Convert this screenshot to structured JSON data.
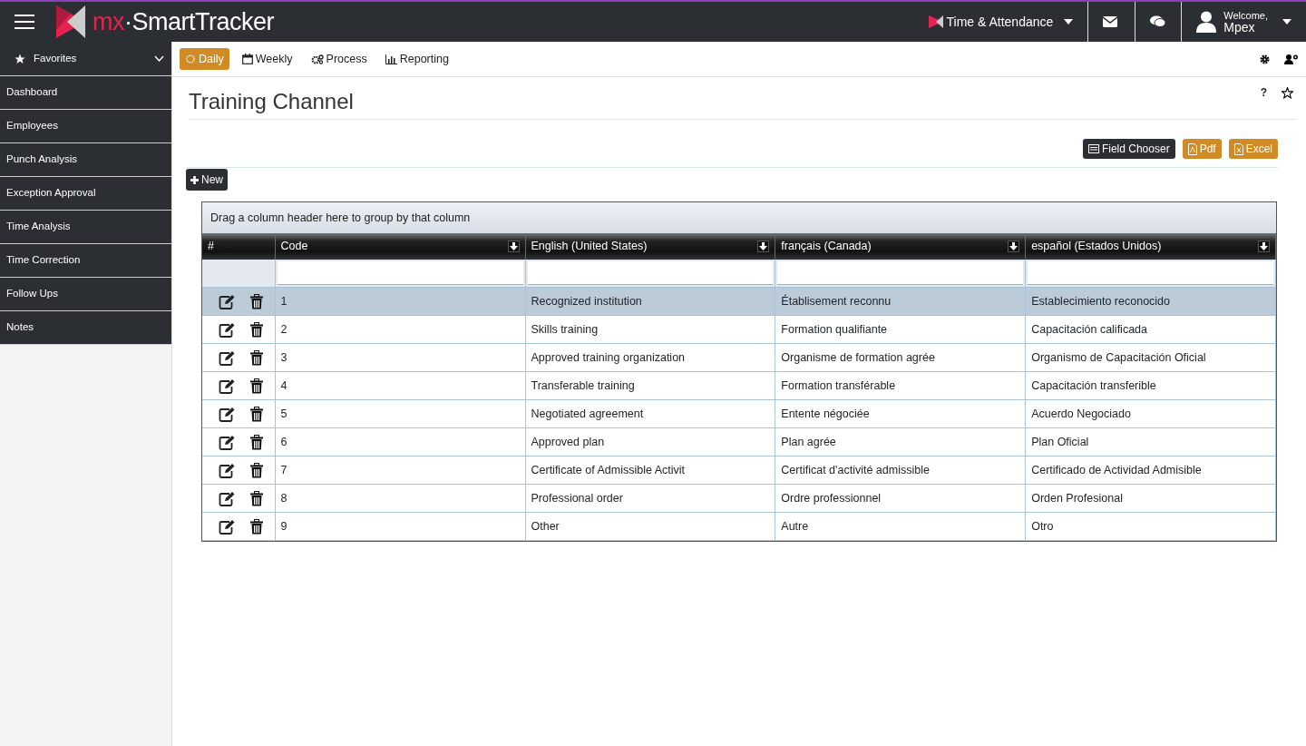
{
  "header": {
    "logo_prefix": "mx",
    "logo_suffix": "·SmartTracker",
    "module": "Time & Attendance",
    "welcome": "Welcome,",
    "user": "Mpex"
  },
  "sidebar": {
    "favorites": "Favorites",
    "items": [
      {
        "label": "Dashboard"
      },
      {
        "label": "Employees"
      },
      {
        "label": "Punch Analysis"
      },
      {
        "label": "Exception Approval"
      },
      {
        "label": "Time Analysis"
      },
      {
        "label": "Time Correction"
      },
      {
        "label": "Follow Ups"
      },
      {
        "label": "Notes"
      }
    ]
  },
  "tabs": [
    {
      "label": "Daily",
      "kind": "sun",
      "selected": true
    },
    {
      "label": "Weekly",
      "kind": "calendar",
      "selected": false
    },
    {
      "label": "Process",
      "kind": "gears",
      "selected": false
    },
    {
      "label": "Reporting",
      "kind": "chart",
      "selected": false
    }
  ],
  "page_title": "Training Channel",
  "help": "?",
  "actions": [
    {
      "label": "Field Chooser",
      "kind": "list"
    },
    {
      "label": "Pdf",
      "kind": "pdf"
    },
    {
      "label": "Excel",
      "kind": "excel"
    }
  ],
  "new_button": "New",
  "grid": {
    "group_hint": "Drag a column header here to group by that column",
    "columns": [
      "#",
      "Code",
      "English (United States)",
      "français (Canada)",
      "español (Estados Unidos)"
    ],
    "rows": [
      {
        "code": "1",
        "en": "Recognized institution",
        "fr": "Établisement reconnu",
        "es": "Establecimiento reconocido",
        "selected": true
      },
      {
        "code": "2",
        "en": "Skills training",
        "fr": "Formation qualifiante",
        "es": "Capacitación calificada",
        "selected": false
      },
      {
        "code": "3",
        "en": "Approved training organization",
        "fr": "Organisme de formation agrée",
        "es": "Organismo de Capacitación Oficial",
        "selected": false
      },
      {
        "code": "4",
        "en": "Transferable training",
        "fr": "Formation transférable",
        "es": "Capacitación transferible",
        "selected": false
      },
      {
        "code": "5",
        "en": "Negotiated agreement",
        "fr": "Entente négociée",
        "es": "Acuerdo Negociado",
        "selected": false
      },
      {
        "code": "6",
        "en": "Approved plan",
        "fr": "Plan agrée",
        "es": "Plan Oficial",
        "selected": false
      },
      {
        "code": "7",
        "en": "Certificate of Admissible Activit",
        "fr": "Certificat d'activité admissible",
        "es": "Certificado de Actividad Admisible",
        "selected": false
      },
      {
        "code": "8",
        "en": "Professional order",
        "fr": "Ordre professionnel",
        "es": "Orden Profesional",
        "selected": false
      },
      {
        "code": "9",
        "en": "Other",
        "fr": "Autre",
        "es": "Otro",
        "selected": false
      }
    ]
  }
}
